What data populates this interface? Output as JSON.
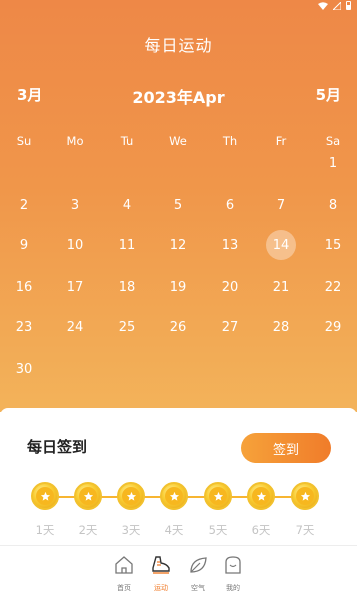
{
  "header": {
    "title": "每日运动",
    "prev_month": "3月",
    "current_month": "2023年Apr",
    "next_month": "5月"
  },
  "calendar": {
    "weekdays": [
      "Su",
      "Mo",
      "Tu",
      "We",
      "Th",
      "Fr",
      "Sa"
    ],
    "today": "14",
    "weeks": [
      [
        "",
        "",
        "",
        "",
        "",
        "",
        "1"
      ],
      [
        "2",
        "3",
        "4",
        "5",
        "6",
        "7",
        "8"
      ],
      [
        "9",
        "10",
        "11",
        "12",
        "13",
        "14",
        "15"
      ],
      [
        "16",
        "17",
        "18",
        "19",
        "20",
        "21",
        "22"
      ],
      [
        "23",
        "24",
        "25",
        "26",
        "27",
        "28",
        "29"
      ],
      [
        "30",
        "",
        "",
        "",
        "",
        "",
        ""
      ]
    ]
  },
  "checkin": {
    "title": "每日签到",
    "button_label": "签到",
    "days": [
      "1天",
      "2天",
      "3天",
      "4天",
      "5天",
      "6天",
      "7天"
    ]
  },
  "nav": {
    "items": [
      {
        "label": "首页",
        "icon": "home-icon",
        "active": false
      },
      {
        "label": "运动",
        "icon": "shoe-icon",
        "active": true
      },
      {
        "label": "空气",
        "icon": "leaf-icon",
        "active": false
      },
      {
        "label": "我的",
        "icon": "profile-icon",
        "active": false
      }
    ]
  },
  "colors": {
    "accent": "#f07c2a",
    "gradient_top": "#ee8847",
    "gradient_bottom": "#f3b35a",
    "coin": "#f9cd33"
  }
}
